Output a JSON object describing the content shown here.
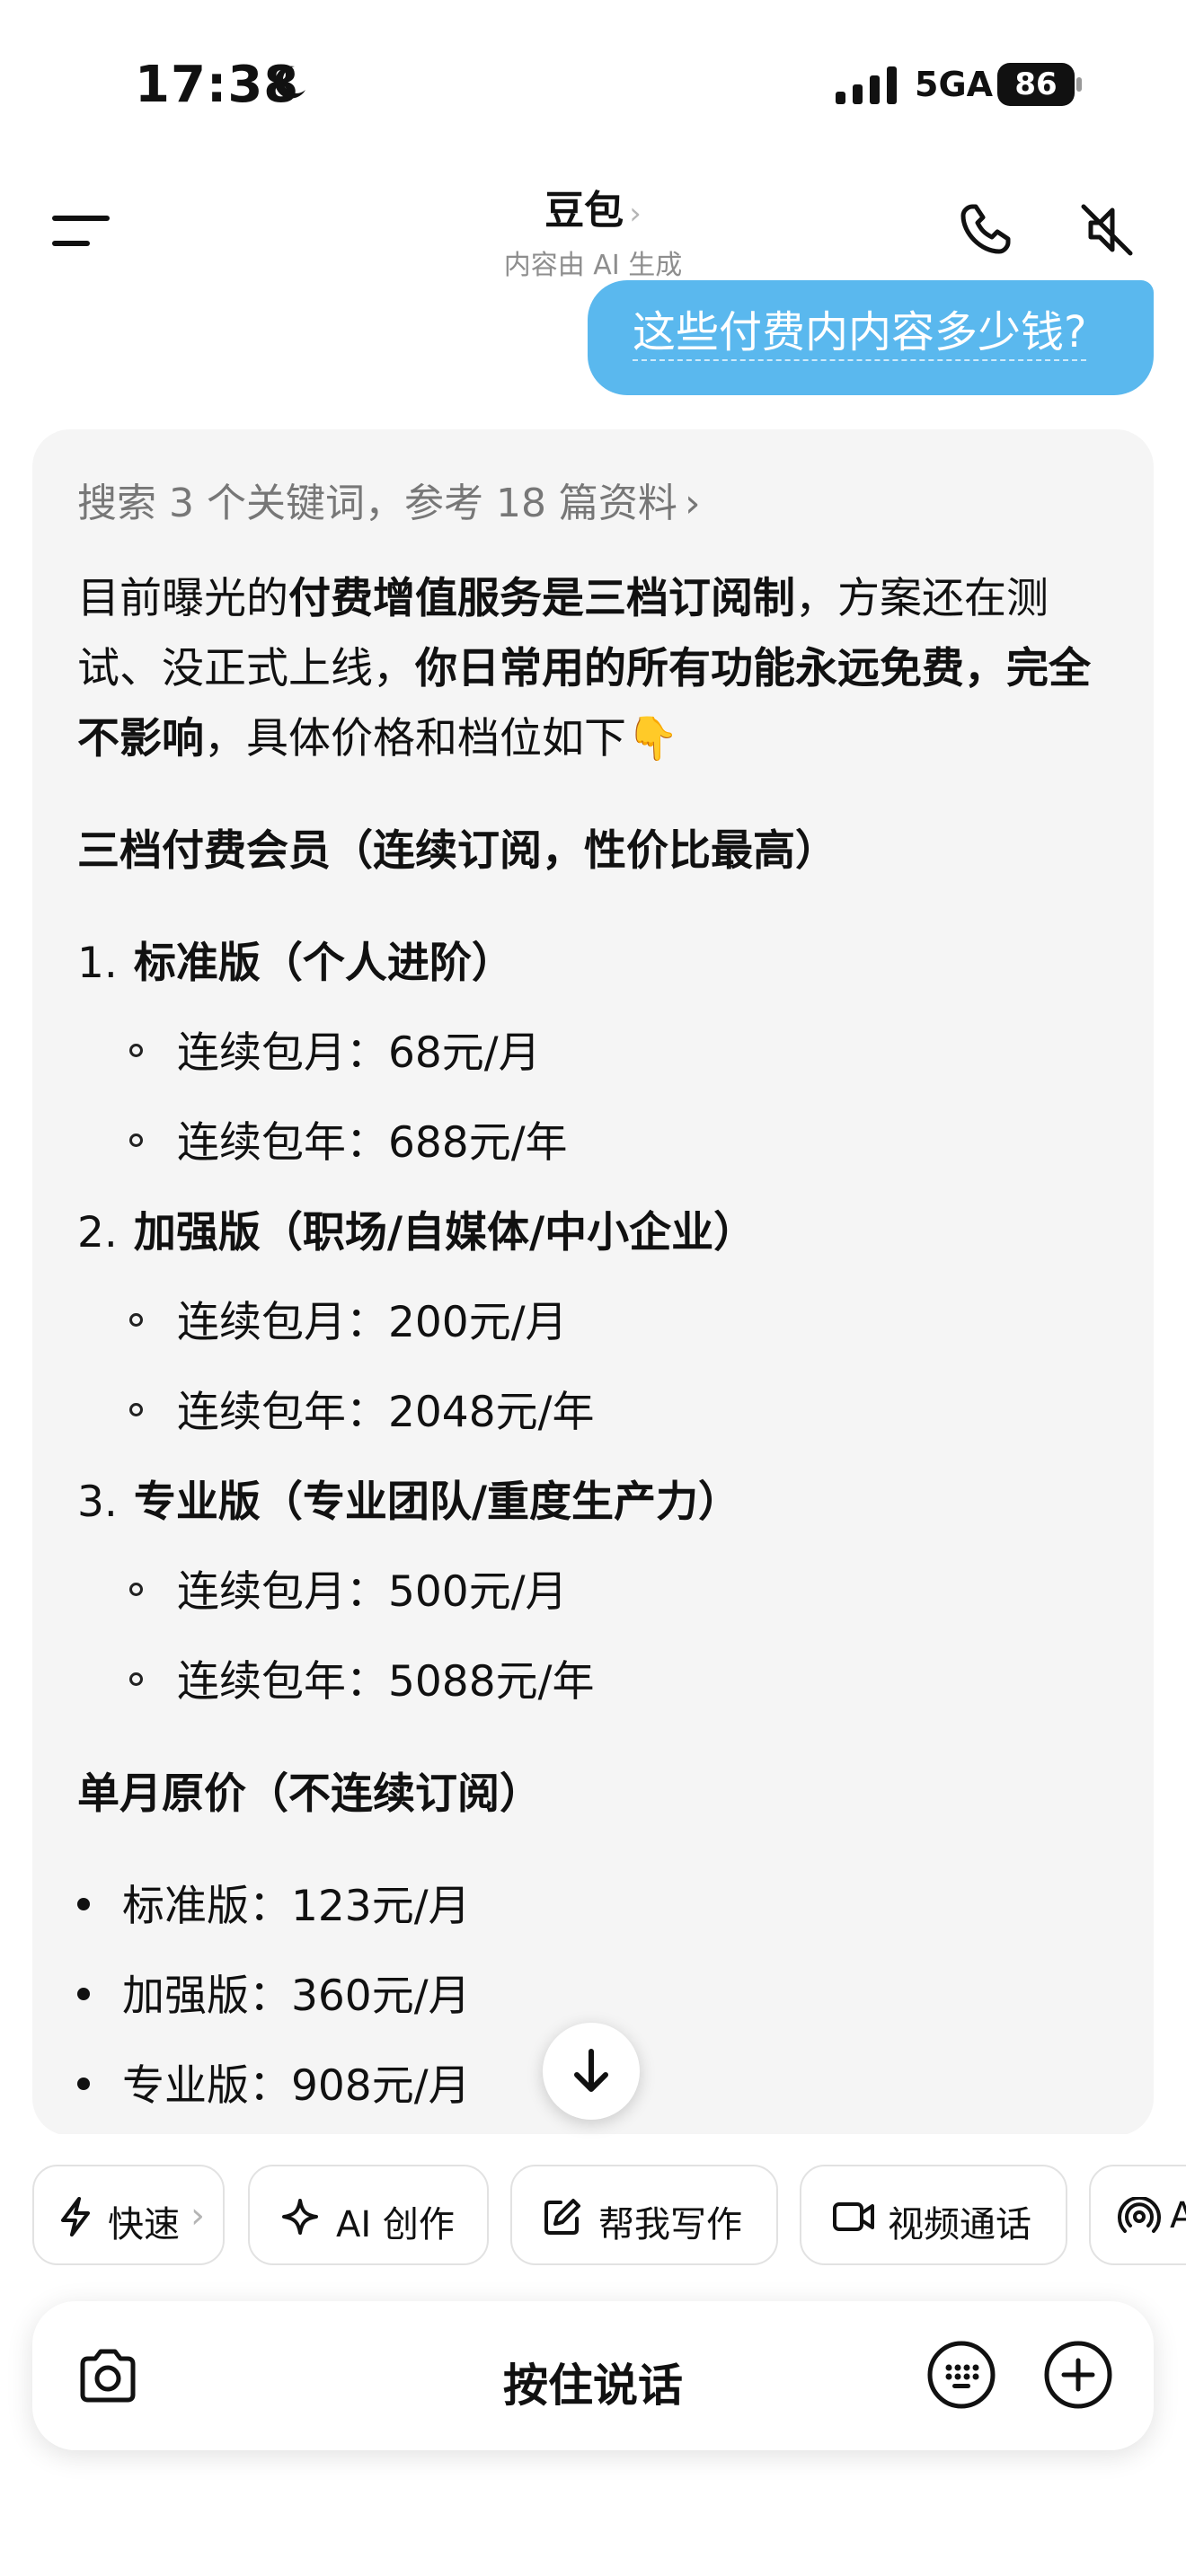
{
  "status_bar": {
    "time": "17:38",
    "network": "5GA",
    "battery": "86"
  },
  "header": {
    "title": "豆包",
    "title_chevron": "›",
    "subtitle": "内容由 AI 生成"
  },
  "user_message": "这些付费内内容多少钱?",
  "ai_response": {
    "search_meta": "搜索 3 个关键词，参考 18 篇资料",
    "search_chevron": "›",
    "intro_parts": {
      "p1": "目前曝光的",
      "p2": "付费增值服务是三档订阅制",
      "p3": "，方案还在测试、没正式上线，",
      "p4": "你日常用的所有功能永远免费，完全不影响",
      "p5": "，具体价格和档位如下",
      "emoji": "👇"
    },
    "section1_title": "三档付费会员（连续订阅，性价比最高）",
    "plans": [
      {
        "num": "1.",
        "name": "标准版（个人进阶）",
        "monthly": "连续包月：68元/月",
        "yearly": "连续包年：688元/年"
      },
      {
        "num": "2.",
        "name": "加强版（职场/自媒体/中小企业）",
        "monthly": "连续包月：200元/月",
        "yearly": "连续包年：2048元/年"
      },
      {
        "num": "3.",
        "name": "专业版（专业团队/重度生产力）",
        "monthly": "连续包月：500元/月",
        "yearly": "连续包年：5088元/年"
      }
    ],
    "section2_title": "单月原价（不连续订阅）",
    "single_prices": [
      "标准版：123元/月",
      "加强版：360元/月",
      "专业版：908元/月"
    ]
  },
  "quick_actions": [
    {
      "label": "快速",
      "icon": "lightning-icon",
      "suffix": "›"
    },
    {
      "label": "AI 创作",
      "icon": "sparkle-icon"
    },
    {
      "label": "帮我写作",
      "icon": "edit-icon"
    },
    {
      "label": "视频通话",
      "icon": "video-icon"
    },
    {
      "label": "A",
      "icon": "broadcast-icon"
    }
  ],
  "input_bar": {
    "hold_to_talk": "按住说话"
  },
  "colors": {
    "user_bubble": "#5ab8ee",
    "card_background": "#f5f5f5",
    "text": "#111111",
    "muted": "#8e8e8e"
  }
}
